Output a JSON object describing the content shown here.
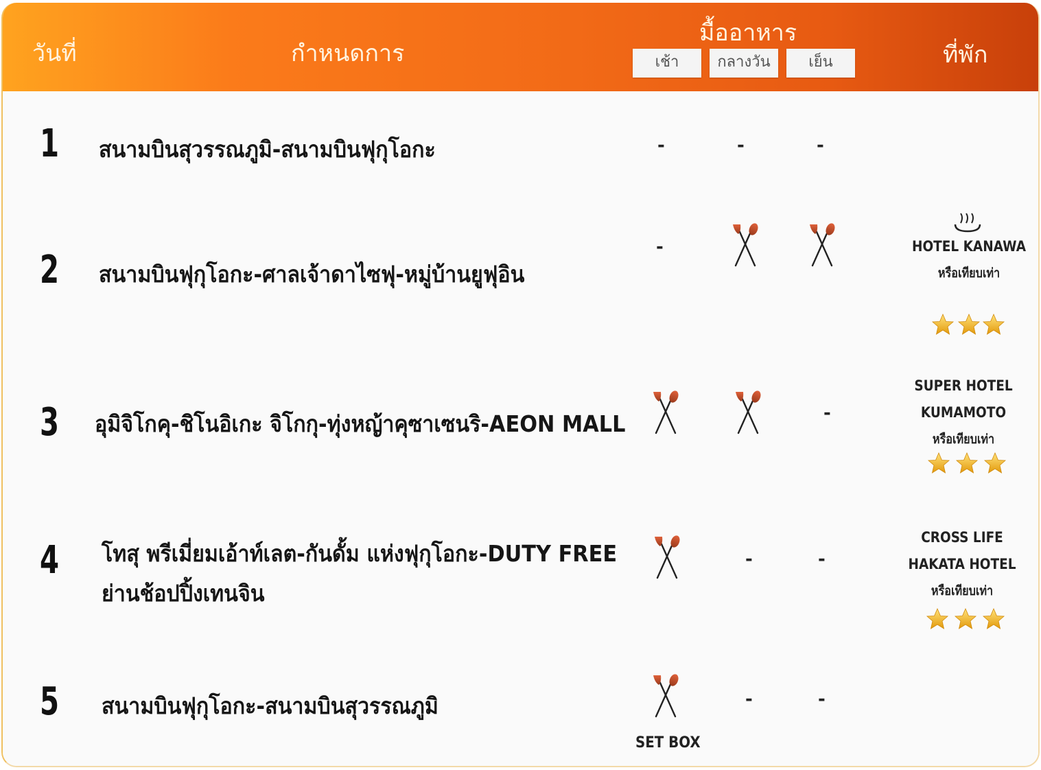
{
  "header": {
    "day_label": "วันที่",
    "itinerary_label": "กำหนดการ",
    "meals_label": "มื้ออาหาร",
    "meal_breakfast": "เช้า",
    "meal_lunch": "กลางวัน",
    "meal_dinner": "เย็น",
    "hotel_label": "ที่พัก"
  },
  "rows": [
    {
      "day": "1",
      "itinerary": "สนามบินสุวรรณภูมิ-สนามบินฟุกุโอกะ",
      "meals": [
        "-",
        "-",
        "-"
      ]
    },
    {
      "day": "2",
      "itinerary": "สนามบินฟุกุโอกะ-ศาลเจ้าดาไซฟุ-หมู่บ้านยูฟุอิน",
      "meals": [
        "-",
        "meal-icon",
        "meal-icon"
      ],
      "hotel_name_1": "HOTEL KANAWA",
      "hotel_or": "หรือเทียบเท่า",
      "hotel_icon": "onsen-icon",
      "stars": 3
    },
    {
      "day": "3",
      "itinerary": "อุมิจิโกคุ-ชิโนอิเกะ จิโกกุ-ทุ่งหญ้าคุซาเซนริ-AEON MALL",
      "meals": [
        "meal-icon",
        "meal-icon",
        "-"
      ],
      "hotel_name_1": "SUPER HOTEL",
      "hotel_name_2": "KUMAMOTO",
      "hotel_or": "หรือเทียบเท่า",
      "stars": 3
    },
    {
      "day": "4",
      "itinerary_line1": "โทสุ พรีเมี่ยมเอ้าท์เลต-กันดั้ม แห่งฟุกุโอกะ-DUTY FREE",
      "itinerary_line2": "ย่านช้อปปิ้งเทนจิน",
      "meals": [
        "meal-icon",
        "-",
        "-"
      ],
      "hotel_name_1": "CROSS LIFE",
      "hotel_name_2": "HAKATA HOTEL",
      "hotel_or": "หรือเทียบเท่า",
      "stars": 3
    },
    {
      "day": "5",
      "itinerary": "สนามบินฟุกุโอกะ-สนามบินสุวรรณภูมิ",
      "meals": [
        "meal-icon",
        "-",
        "-"
      ],
      "breakfast_note": "SET BOX"
    }
  ],
  "colors": {
    "header_gradient_start": "#ffa31f",
    "header_gradient_end": "#c8400a",
    "star": "#f2b418"
  }
}
